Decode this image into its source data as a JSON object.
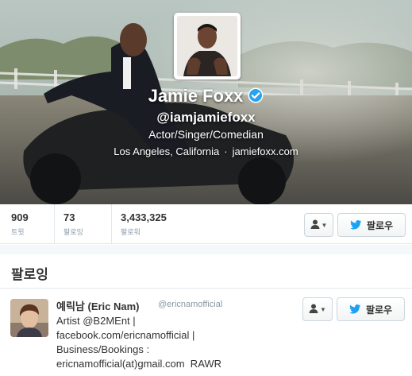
{
  "profile": {
    "name": "Jamie Foxx",
    "handle": "@iamjamiefoxx",
    "bio": "Actor/Singer/Comedian",
    "location": "Los Angeles, California",
    "separator": "·",
    "website": "jamiefoxx.com",
    "verified": true
  },
  "stats": [
    {
      "value": "909",
      "label": "트윗"
    },
    {
      "value": "73",
      "label": "팔로잉"
    },
    {
      "value": "3,433,325",
      "label": "팔로워"
    }
  ],
  "actions": {
    "follow_label": "팔로우"
  },
  "section": {
    "title": "팔로잉"
  },
  "following": [
    {
      "name": "예릭남 (Eric Nam)",
      "handle": "@ericnamofficial",
      "bio_lines": [
        "Artist @B2MEnt |",
        "facebook.com/ericnamofficial |",
        "Business/Bookings :",
        "ericnamofficial(at)gmail.com  RAWR"
      ],
      "follow_label": "팔로우"
    }
  ],
  "colors": {
    "accent": "#1da1f2",
    "verified": "#2aa3ef",
    "muted": "#8899a6"
  },
  "icons": {
    "verified": "verified-badge-icon",
    "user_menu": "person-icon",
    "follow": "twitter-bird-icon"
  }
}
